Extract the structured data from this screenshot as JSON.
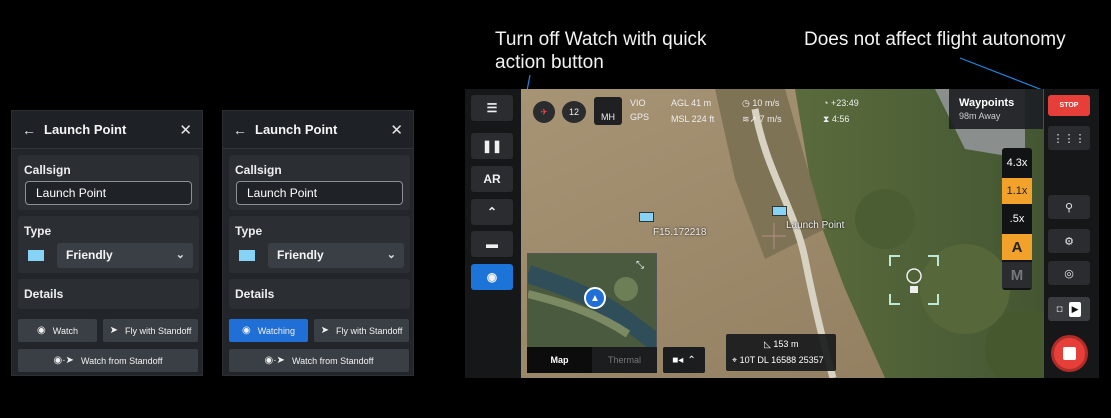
{
  "annotations": {
    "left": "Turn off Watch with quick action button",
    "left_line1": "Turn off Watch with quick",
    "left_line2": "action button",
    "right": "Does not affect flight autonomy"
  },
  "panel1": {
    "title": "Launch Point",
    "callsign_label": "Callsign",
    "callsign_value": "Launch Point",
    "type_label": "Type",
    "type_value": "Friendly",
    "details_label": "Details",
    "watch_btn": "Watch",
    "fly_standoff_btn": "Fly with Standoff",
    "watch_standoff_btn": "Watch from Standoff"
  },
  "panel2": {
    "title": "Launch Point",
    "callsign_label": "Callsign",
    "callsign_value": "Launch Point",
    "type_label": "Type",
    "type_value": "Friendly",
    "details_label": "Details",
    "watch_btn": "Watching",
    "fly_standoff_btn": "Fly with Standoff",
    "watch_standoff_btn": "Watch from Standoff"
  },
  "drone": {
    "satellites": "12",
    "mode": "MH",
    "vio_label": "VIO",
    "gps_label": "GPS",
    "agl": "AGL 41 m",
    "msl": "MSL 224 ft",
    "speed": "10 m/s",
    "wind": "7 m/s",
    "time_plus": "+23:49",
    "time_remaining": "4:56",
    "waypoints_title": "Waypoints",
    "waypoints_distance": "98m Away",
    "stop_label": "STOP",
    "rail_ar": "AR",
    "zoom_levels": [
      "4.3x",
      "1.1x",
      ".5x"
    ],
    "mode_a": "A",
    "mode_m": "M",
    "marker_label": "Launch Point",
    "feature_label": "F15.172218",
    "distance": "153 m",
    "coordinates": "10T DL 16588 25357",
    "map_tab": "Map",
    "thermal_tab": "Thermal"
  },
  "colors": {
    "accent_blue": "#1f6fd6",
    "friendly": "#87d3f5",
    "stop_red": "#e63f3a",
    "zoom_selected": "#f2a22a"
  }
}
